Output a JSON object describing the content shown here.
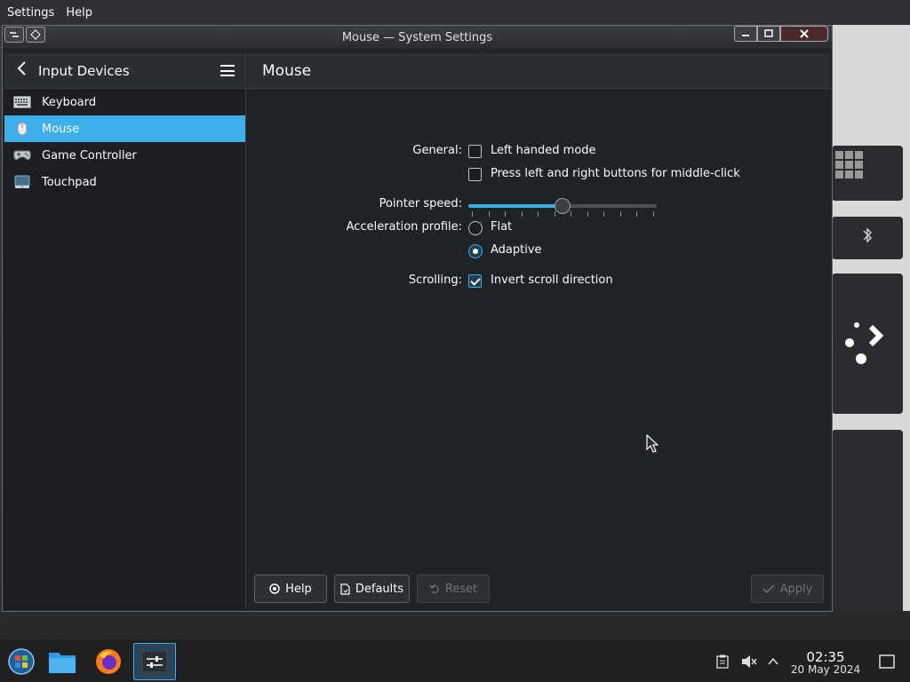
{
  "global_menu": [
    "Settings",
    "Help"
  ],
  "window": {
    "title": "Mouse — System Settings"
  },
  "sidebar": {
    "title": "Input Devices",
    "items": [
      {
        "label": "Keyboard",
        "icon": "keyboard-icon",
        "active": false
      },
      {
        "label": "Mouse",
        "icon": "mouse-icon",
        "active": true
      },
      {
        "label": "Game Controller",
        "icon": "gamepad-icon",
        "active": false
      },
      {
        "label": "Touchpad",
        "icon": "touchpad-icon",
        "active": false
      }
    ]
  },
  "main": {
    "title": "Mouse",
    "general": {
      "label": "General:",
      "left_handed": {
        "label": "Left handed mode",
        "checked": false
      },
      "middle_click": {
        "label": "Press left and right buttons for middle-click",
        "checked": false
      }
    },
    "pointer_speed": {
      "label": "Pointer speed:",
      "value_fraction": 0.5
    },
    "acceleration": {
      "label": "Acceleration profile:",
      "options": [
        {
          "label": "Flat",
          "selected": false
        },
        {
          "label": "Adaptive",
          "selected": true
        }
      ]
    },
    "scrolling": {
      "label": "Scrolling:",
      "invert": {
        "label": "Invert scroll direction",
        "checked": true
      }
    }
  },
  "buttons": {
    "help": "Help",
    "defaults": "Defaults",
    "reset": "Reset",
    "apply": "Apply"
  },
  "taskbar": {
    "time": "02:35",
    "date": "20 May 2024"
  },
  "colors": {
    "accent": "#3daee9",
    "window_bg": "#202326"
  }
}
